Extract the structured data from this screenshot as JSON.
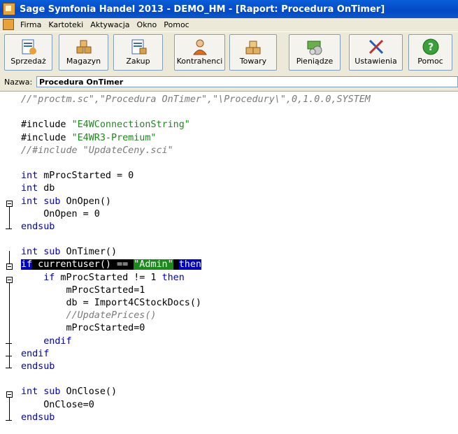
{
  "window": {
    "title": "Sage Symfonia Handel 2013 - DEMO_HM - [Raport: Procedura OnTimer]"
  },
  "menu": [
    "Firma",
    "Kartoteki",
    "Aktywacja",
    "Okno",
    "Pomoc"
  ],
  "toolbar": [
    {
      "label": "Sprzedaż",
      "icon": "sales-icon"
    },
    {
      "label": "Magazyn",
      "icon": "warehouse-icon"
    },
    {
      "label": "Zakup",
      "icon": "purchase-icon"
    },
    {
      "label": "Kontrahenci",
      "icon": "contractors-icon"
    },
    {
      "label": "Towary",
      "icon": "goods-icon"
    },
    {
      "label": "Pieniądze",
      "icon": "money-icon"
    },
    {
      "label": "Ustawienia",
      "icon": "settings-icon"
    },
    {
      "label": "Pomoc",
      "icon": "help-icon"
    }
  ],
  "name_field": {
    "label": "Nazwa:",
    "value": "Procedura OnTimer"
  },
  "code_lines": [
    [
      [
        "cmt",
        "//\"proctm.sc\",\"Procedura OnTimer\",\"\\Procedury\\\",0,1.0.0,SYSTEM"
      ]
    ],
    [],
    [
      [
        "plain",
        "#include "
      ],
      [
        "str",
        "\"E4WConnectionString\""
      ]
    ],
    [
      [
        "plain",
        "#include "
      ],
      [
        "str",
        "\"E4WR3-Premium\""
      ]
    ],
    [
      [
        "cmt",
        "//#include \"UpdateCeny.sci\""
      ]
    ],
    [],
    [
      [
        "kw",
        "int"
      ],
      [
        "plain",
        " mProcStarted = 0"
      ]
    ],
    [
      [
        "kw",
        "int"
      ],
      [
        "plain",
        " db"
      ]
    ],
    [
      [
        "kw",
        "int"
      ],
      [
        "plain",
        " "
      ],
      [
        "kw",
        "sub"
      ],
      [
        "plain",
        " OnOpen()"
      ]
    ],
    [
      [
        "plain",
        "    OnOpen = 0"
      ]
    ],
    [
      [
        "kw",
        "endsub"
      ]
    ],
    [],
    [
      [
        "kw",
        "int"
      ],
      [
        "plain",
        " "
      ],
      [
        "kw",
        "sub"
      ],
      [
        "plain",
        " OnTimer()"
      ]
    ],
    [
      [
        "sel-kw",
        "if"
      ],
      [
        "sel",
        " currentuser() == "
      ],
      [
        "sel-str",
        "\"Admin\""
      ],
      [
        "sel",
        " "
      ],
      [
        "sel-kw",
        "then"
      ]
    ],
    [
      [
        "plain",
        "    "
      ],
      [
        "kw",
        "if"
      ],
      [
        "plain",
        " mProcStarted != 1 "
      ],
      [
        "kw",
        "then"
      ]
    ],
    [
      [
        "plain",
        "        mProcStarted=1"
      ]
    ],
    [
      [
        "plain",
        "        db = Import4CStockDocs()"
      ]
    ],
    [
      [
        "plain",
        "        "
      ],
      [
        "cmt",
        "//UpdatePrices()"
      ]
    ],
    [
      [
        "plain",
        "        mProcStarted=0"
      ]
    ],
    [
      [
        "plain",
        "    "
      ],
      [
        "kw",
        "endif"
      ]
    ],
    [
      [
        "kw",
        "endif"
      ]
    ],
    [
      [
        "kw",
        "endsub"
      ]
    ],
    [],
    [
      [
        "kw",
        "int"
      ],
      [
        "plain",
        " "
      ],
      [
        "kw",
        "sub"
      ],
      [
        "plain",
        " OnClose()"
      ]
    ],
    [
      [
        "plain",
        "    OnClose=0"
      ]
    ],
    [
      [
        "kw",
        "endsub"
      ]
    ]
  ],
  "colors": {
    "titlebar": "#0348c4",
    "keyword": "#0000c0",
    "string": "#1a8a1a",
    "comment": "#7a7a7a"
  }
}
